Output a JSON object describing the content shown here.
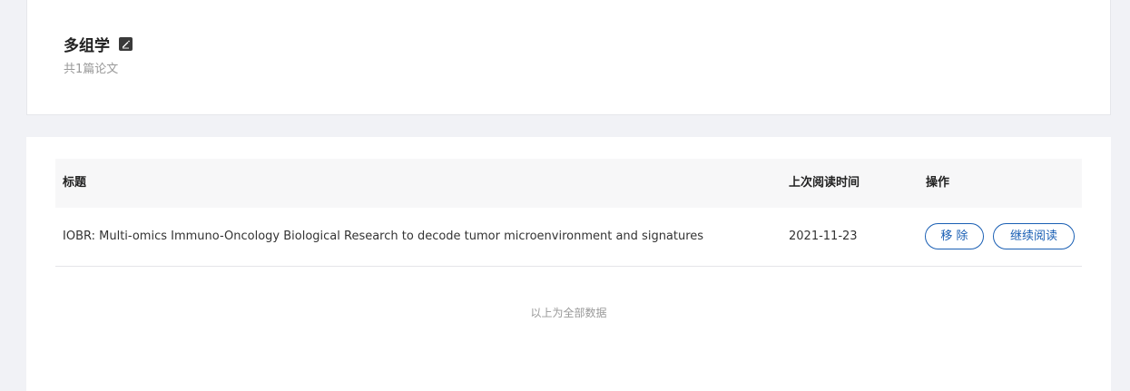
{
  "folder": {
    "title": "多组学",
    "count_text": "共1篇论文"
  },
  "table": {
    "headers": {
      "title": "标题",
      "last_read": "上次阅读时间",
      "actions": "操作"
    },
    "rows": [
      {
        "title": "IOBR: Multi-omics Immuno-Oncology Biological Research to decode tumor microenvironment and signatures",
        "last_read": "2021-11-23",
        "remove_label": "移 除",
        "continue_label": "继续阅读"
      }
    ],
    "footer_text": "以上为全部数据"
  },
  "colors": {
    "accent": "#1a5fb4",
    "background": "#f1f2f6"
  }
}
